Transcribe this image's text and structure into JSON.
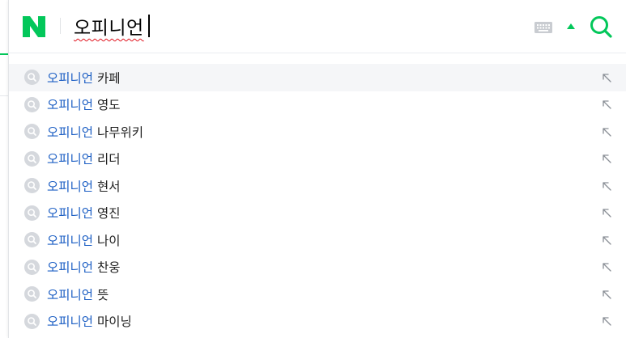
{
  "search": {
    "query": "오피니언",
    "logo_letter": "N"
  },
  "suggestions": [
    {
      "keyword": "오피니언",
      "suffix": "카페"
    },
    {
      "keyword": "오피니언",
      "suffix": "영도"
    },
    {
      "keyword": "오피니언",
      "suffix": "나무위키"
    },
    {
      "keyword": "오피니언",
      "suffix": "리더"
    },
    {
      "keyword": "오피니언",
      "suffix": "현서"
    },
    {
      "keyword": "오피니언",
      "suffix": "영진"
    },
    {
      "keyword": "오피니언",
      "suffix": "나이"
    },
    {
      "keyword": "오피니언",
      "suffix": "찬웅"
    },
    {
      "keyword": "오피니언",
      "suffix": "뜻"
    },
    {
      "keyword": "오피니언",
      "suffix": "마이닝"
    }
  ],
  "icons": {
    "logo": "naver-logo-icon",
    "keyboard": "keyboard-icon",
    "collapse": "caret-up-icon",
    "search": "search-icon",
    "suggestion": "magnifier-icon",
    "fill_arrow": "arrow-up-left-icon"
  },
  "colors": {
    "brand_green": "#03c75a",
    "keyword_blue": "#1d5fc4",
    "active_row": "#f5f6f8"
  }
}
